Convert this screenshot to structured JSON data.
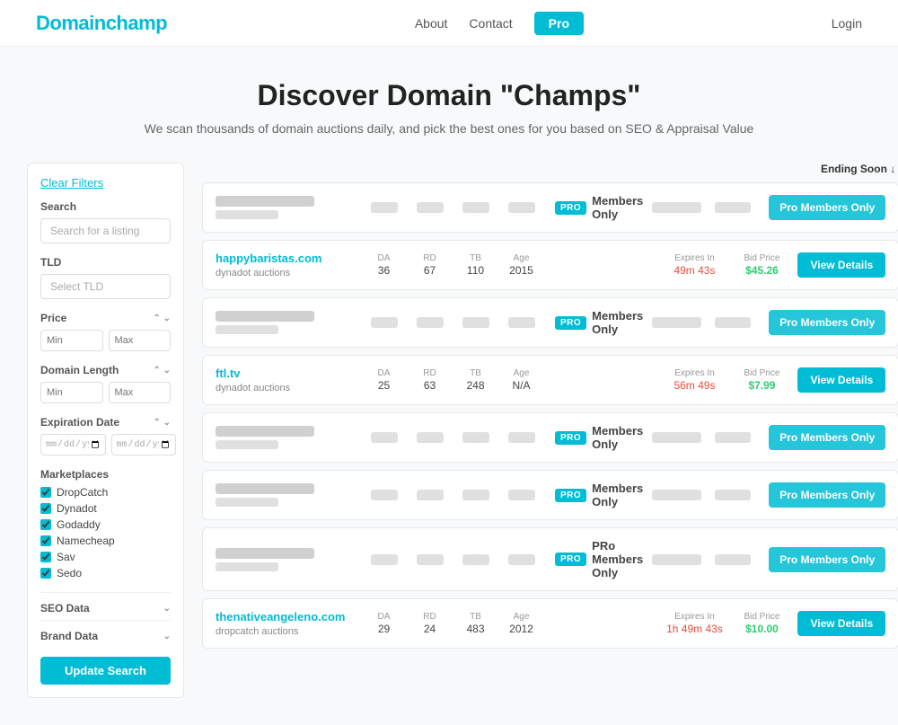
{
  "header": {
    "logo_domain": "Domain",
    "logo_champ": "champ",
    "nav": {
      "about": "About",
      "contact": "Contact",
      "pro": "Pro",
      "login": "Login"
    }
  },
  "hero": {
    "title": "Discover Domain \"Champs\"",
    "subtitle": "We scan thousands of domain auctions daily, and pick the best ones for you based on SEO & Appraisal Value"
  },
  "sidebar": {
    "clear_filters": "Clear Filters",
    "search_label": "Search",
    "search_placeholder": "Search for a listing",
    "tld_label": "TLD",
    "tld_placeholder": "Select TLD",
    "price_label": "Price",
    "price_min": "Min",
    "price_max": "Max",
    "domain_length_label": "Domain Length",
    "domain_length_min": "Min",
    "domain_length_max": "Max",
    "expiration_label": "Expiration Date",
    "marketplaces_label": "Marketplaces",
    "marketplaces": [
      {
        "name": "DropCatch",
        "checked": true
      },
      {
        "name": "Dynadot",
        "checked": true
      },
      {
        "name": "Godaddy",
        "checked": true
      },
      {
        "name": "Namecheap",
        "checked": true
      },
      {
        "name": "Sav",
        "checked": true
      },
      {
        "name": "Sedo",
        "checked": true
      }
    ],
    "seo_data_label": "SEO Data",
    "brand_data_label": "Brand Data",
    "update_btn": "Update Search"
  },
  "results": {
    "sort_label": "Ending Soon",
    "sort_icon": "↓",
    "rows": [
      {
        "type": "pro",
        "badge": "PRO",
        "members_text": "Members Only",
        "action_btn": "Pro Members Only"
      },
      {
        "type": "normal",
        "domain": "happybaristas.com",
        "marketplace": "dynadot auctions",
        "da_label": "DA",
        "da_value": "36",
        "rd_label": "RD",
        "rd_value": "67",
        "tb_label": "TB",
        "tb_value": "110",
        "age_label": "Age",
        "age_value": "2015",
        "expires_label": "Expires In",
        "expires_value": "49m 43s",
        "bid_label": "Bid Price",
        "bid_value": "$45.26",
        "action_btn": "View Details"
      },
      {
        "type": "pro",
        "badge": "PRO",
        "members_text": "Members Only",
        "action_btn": "Pro Members Only"
      },
      {
        "type": "normal",
        "domain": "ftl.tv",
        "marketplace": "dynadot auctions",
        "da_label": "DA",
        "da_value": "25",
        "rd_label": "RD",
        "rd_value": "63",
        "tb_label": "TB",
        "tb_value": "248",
        "age_label": "Age",
        "age_value": "N/A",
        "expires_label": "Expires In",
        "expires_value": "56m 49s",
        "bid_label": "Bid Price",
        "bid_value": "$7.99",
        "action_btn": "View Details"
      },
      {
        "type": "pro",
        "badge": "PRO",
        "members_text": "Members Only",
        "action_btn": "Pro Members Only"
      },
      {
        "type": "pro",
        "badge": "PRO",
        "members_text": "Members Only",
        "action_btn": "Pro Members Only"
      },
      {
        "type": "pro",
        "badge": "PRO",
        "members_text": "PRo Members Only",
        "action_btn": "Pro Members Only"
      },
      {
        "type": "normal",
        "domain": "thenativeangeleno.com",
        "marketplace": "dropcatch auctions",
        "da_label": "DA",
        "da_value": "29",
        "rd_label": "RD",
        "rd_value": "24",
        "tb_label": "TB",
        "tb_value": "483",
        "age_label": "Age",
        "age_value": "2012",
        "expires_label": "Expires In",
        "expires_value": "1h 49m 43s",
        "bid_label": "Bid Price",
        "bid_value": "$10.00",
        "action_btn": "View Details"
      }
    ]
  }
}
